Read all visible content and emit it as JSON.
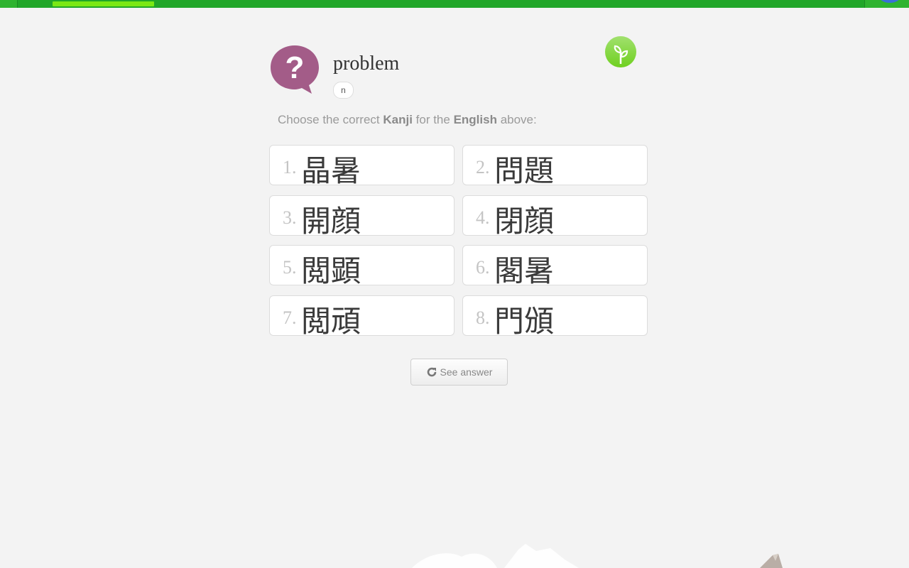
{
  "header": {
    "progress_fraction": 0.12
  },
  "question": {
    "word": "problem",
    "part_of_speech": "n",
    "instructions": {
      "prefix": "Choose the correct ",
      "bold1": "Kanji",
      "middle": " for the ",
      "bold2": "English",
      "suffix": " above:"
    }
  },
  "options": [
    {
      "number": "1.",
      "text": "晶暑"
    },
    {
      "number": "2.",
      "text": "問題"
    },
    {
      "number": "3.",
      "text": "開顔"
    },
    {
      "number": "4.",
      "text": "閉顔"
    },
    {
      "number": "5.",
      "text": "閲顕"
    },
    {
      "number": "6.",
      "text": "閣暑"
    },
    {
      "number": "7.",
      "text": "閲頑"
    },
    {
      "number": "8.",
      "text": "門頒"
    }
  ],
  "actions": {
    "see_answer_label": "See answer"
  },
  "colors": {
    "brand_green": "#2fb330",
    "progress_green": "#7be814",
    "question_icon": "#a35c88",
    "level_icon": "#6fd020"
  },
  "icons": {
    "question": "question-bubble-icon",
    "level": "seedling-icon",
    "refresh": "refresh-icon"
  }
}
